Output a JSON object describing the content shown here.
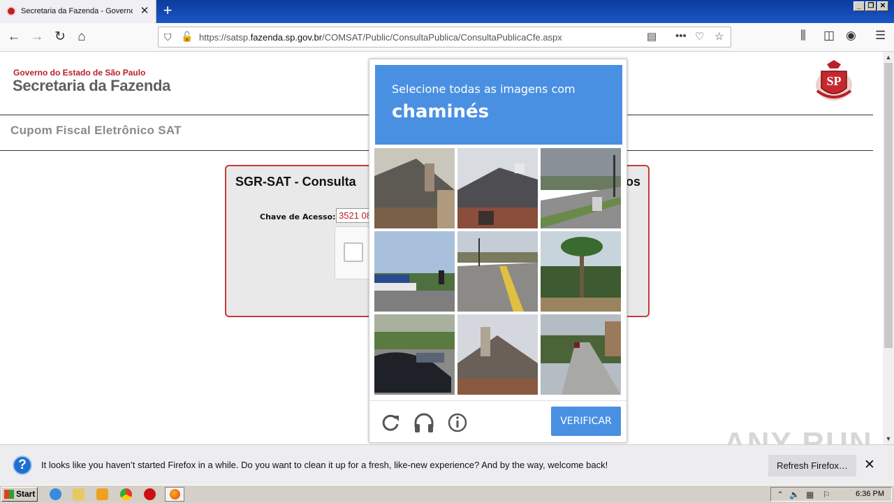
{
  "browser": {
    "tab_title": "Secretaria da Fazenda - Governo do Estado de São Paulo",
    "url_prefix": "https://satsp.",
    "url_domain": "fazenda.sp.gov.br",
    "url_path": "/COMSAT/Public/ConsultaPublica/ConsultaPublicaCfe.aspx"
  },
  "page": {
    "gov_line": "Governo do Estado de São Paulo",
    "sec_line": "Secretaria da Fazenda",
    "logo_text": "SP",
    "cfe_title": "Cupom Fiscal Eletrônico SAT",
    "panel_title": "SGR-SAT - Consulta",
    "panel_title_tail": "os",
    "chave_label": "Chave de Acesso:",
    "chave_value": "3521 08"
  },
  "captcha": {
    "prompt": "Selecione todas as imagens com",
    "target": "chaminés",
    "verify_label": "VERIFICAR",
    "header_color": "#4a90e2",
    "icons": [
      "reload-icon",
      "headphones-icon",
      "info-icon"
    ]
  },
  "notification": {
    "message": "It looks like you haven’t started Firefox in a while. Do you want to clean it up for a fresh, like-new experience? And by the way, welcome back!",
    "refresh_label": "Refresh Firefox…"
  },
  "watermark": "ANY RUN",
  "taskbar": {
    "start_label": "Start",
    "clock": "6:36 PM"
  }
}
